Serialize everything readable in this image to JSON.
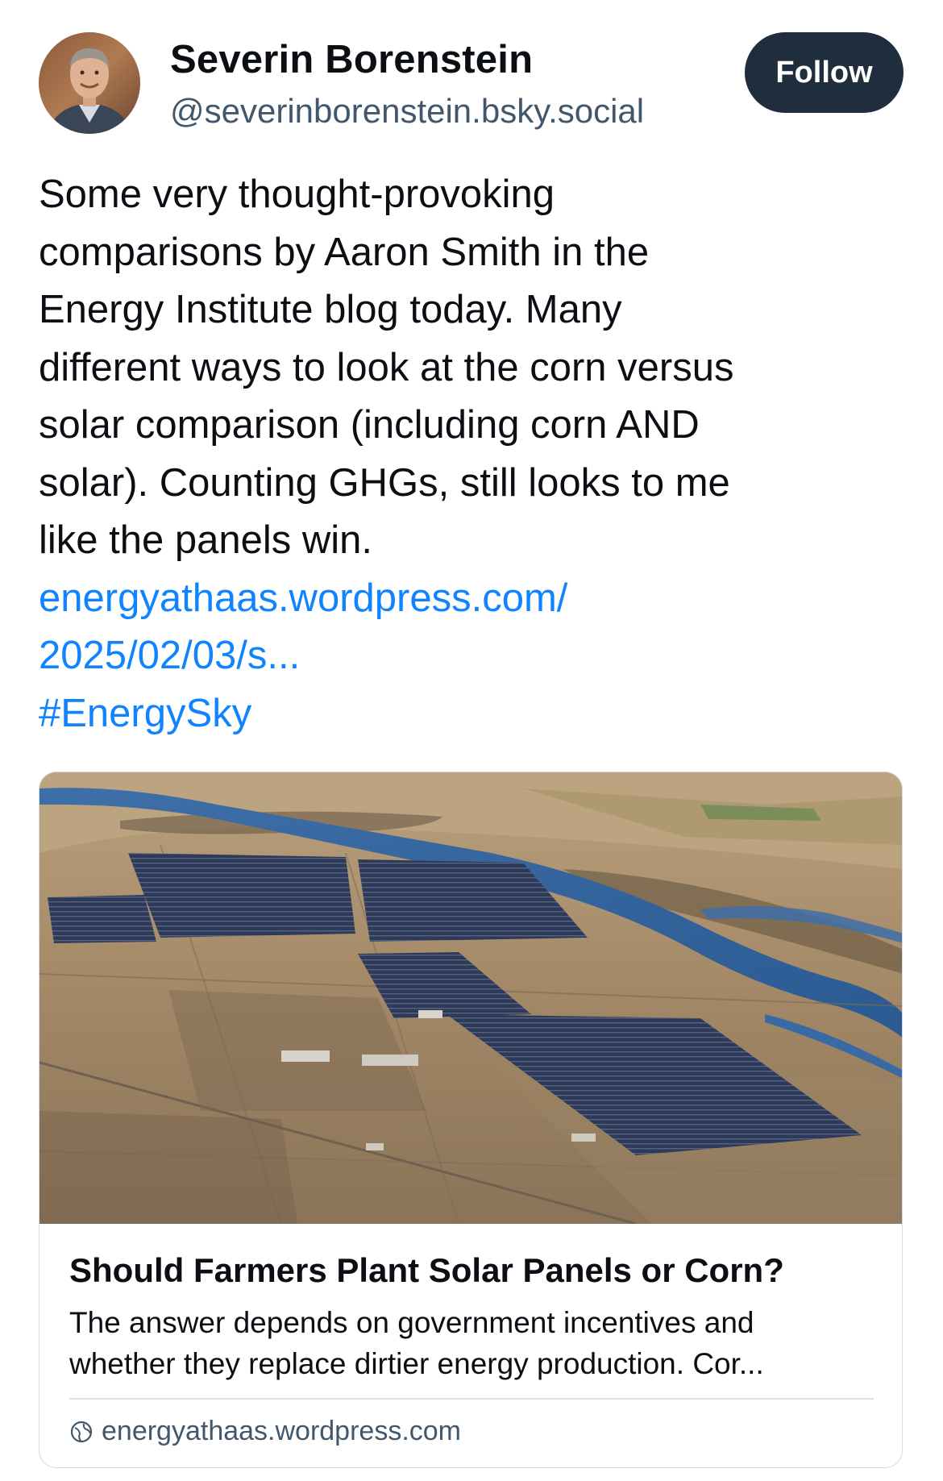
{
  "author": {
    "name": "Severin Borenstein",
    "handle": "@severinborenstein.bsky.social",
    "avatar_icon": "avatar-photo"
  },
  "follow_button": {
    "label": "Follow"
  },
  "post": {
    "text_lines": [
      "Some very thought-provoking",
      "comparisons by Aaron Smith in the",
      "Energy Institute blog today.  Many",
      "different ways to look at the corn versus",
      "solar comparison (including corn AND",
      "solar). Counting GHGs, still looks to me",
      "like the panels win."
    ],
    "link_line1": "energyathaas.wordpress.com/",
    "link_line2": "2025/02/03/s...",
    "hashtag": "#EnergySky"
  },
  "link_card": {
    "image_icon": "aerial-solar-farm-image",
    "title": "Should Farmers Plant Solar Panels or Corn?",
    "description_lines": [
      "The answer depends on government incentives and",
      "whether they replace dirtier energy production. Cor..."
    ],
    "domain": "energyathaas.wordpress.com",
    "domain_icon": "globe-icon"
  },
  "colors": {
    "link": "#1083fe",
    "button_bg": "#1f2d3d",
    "handle": "#42576c"
  }
}
